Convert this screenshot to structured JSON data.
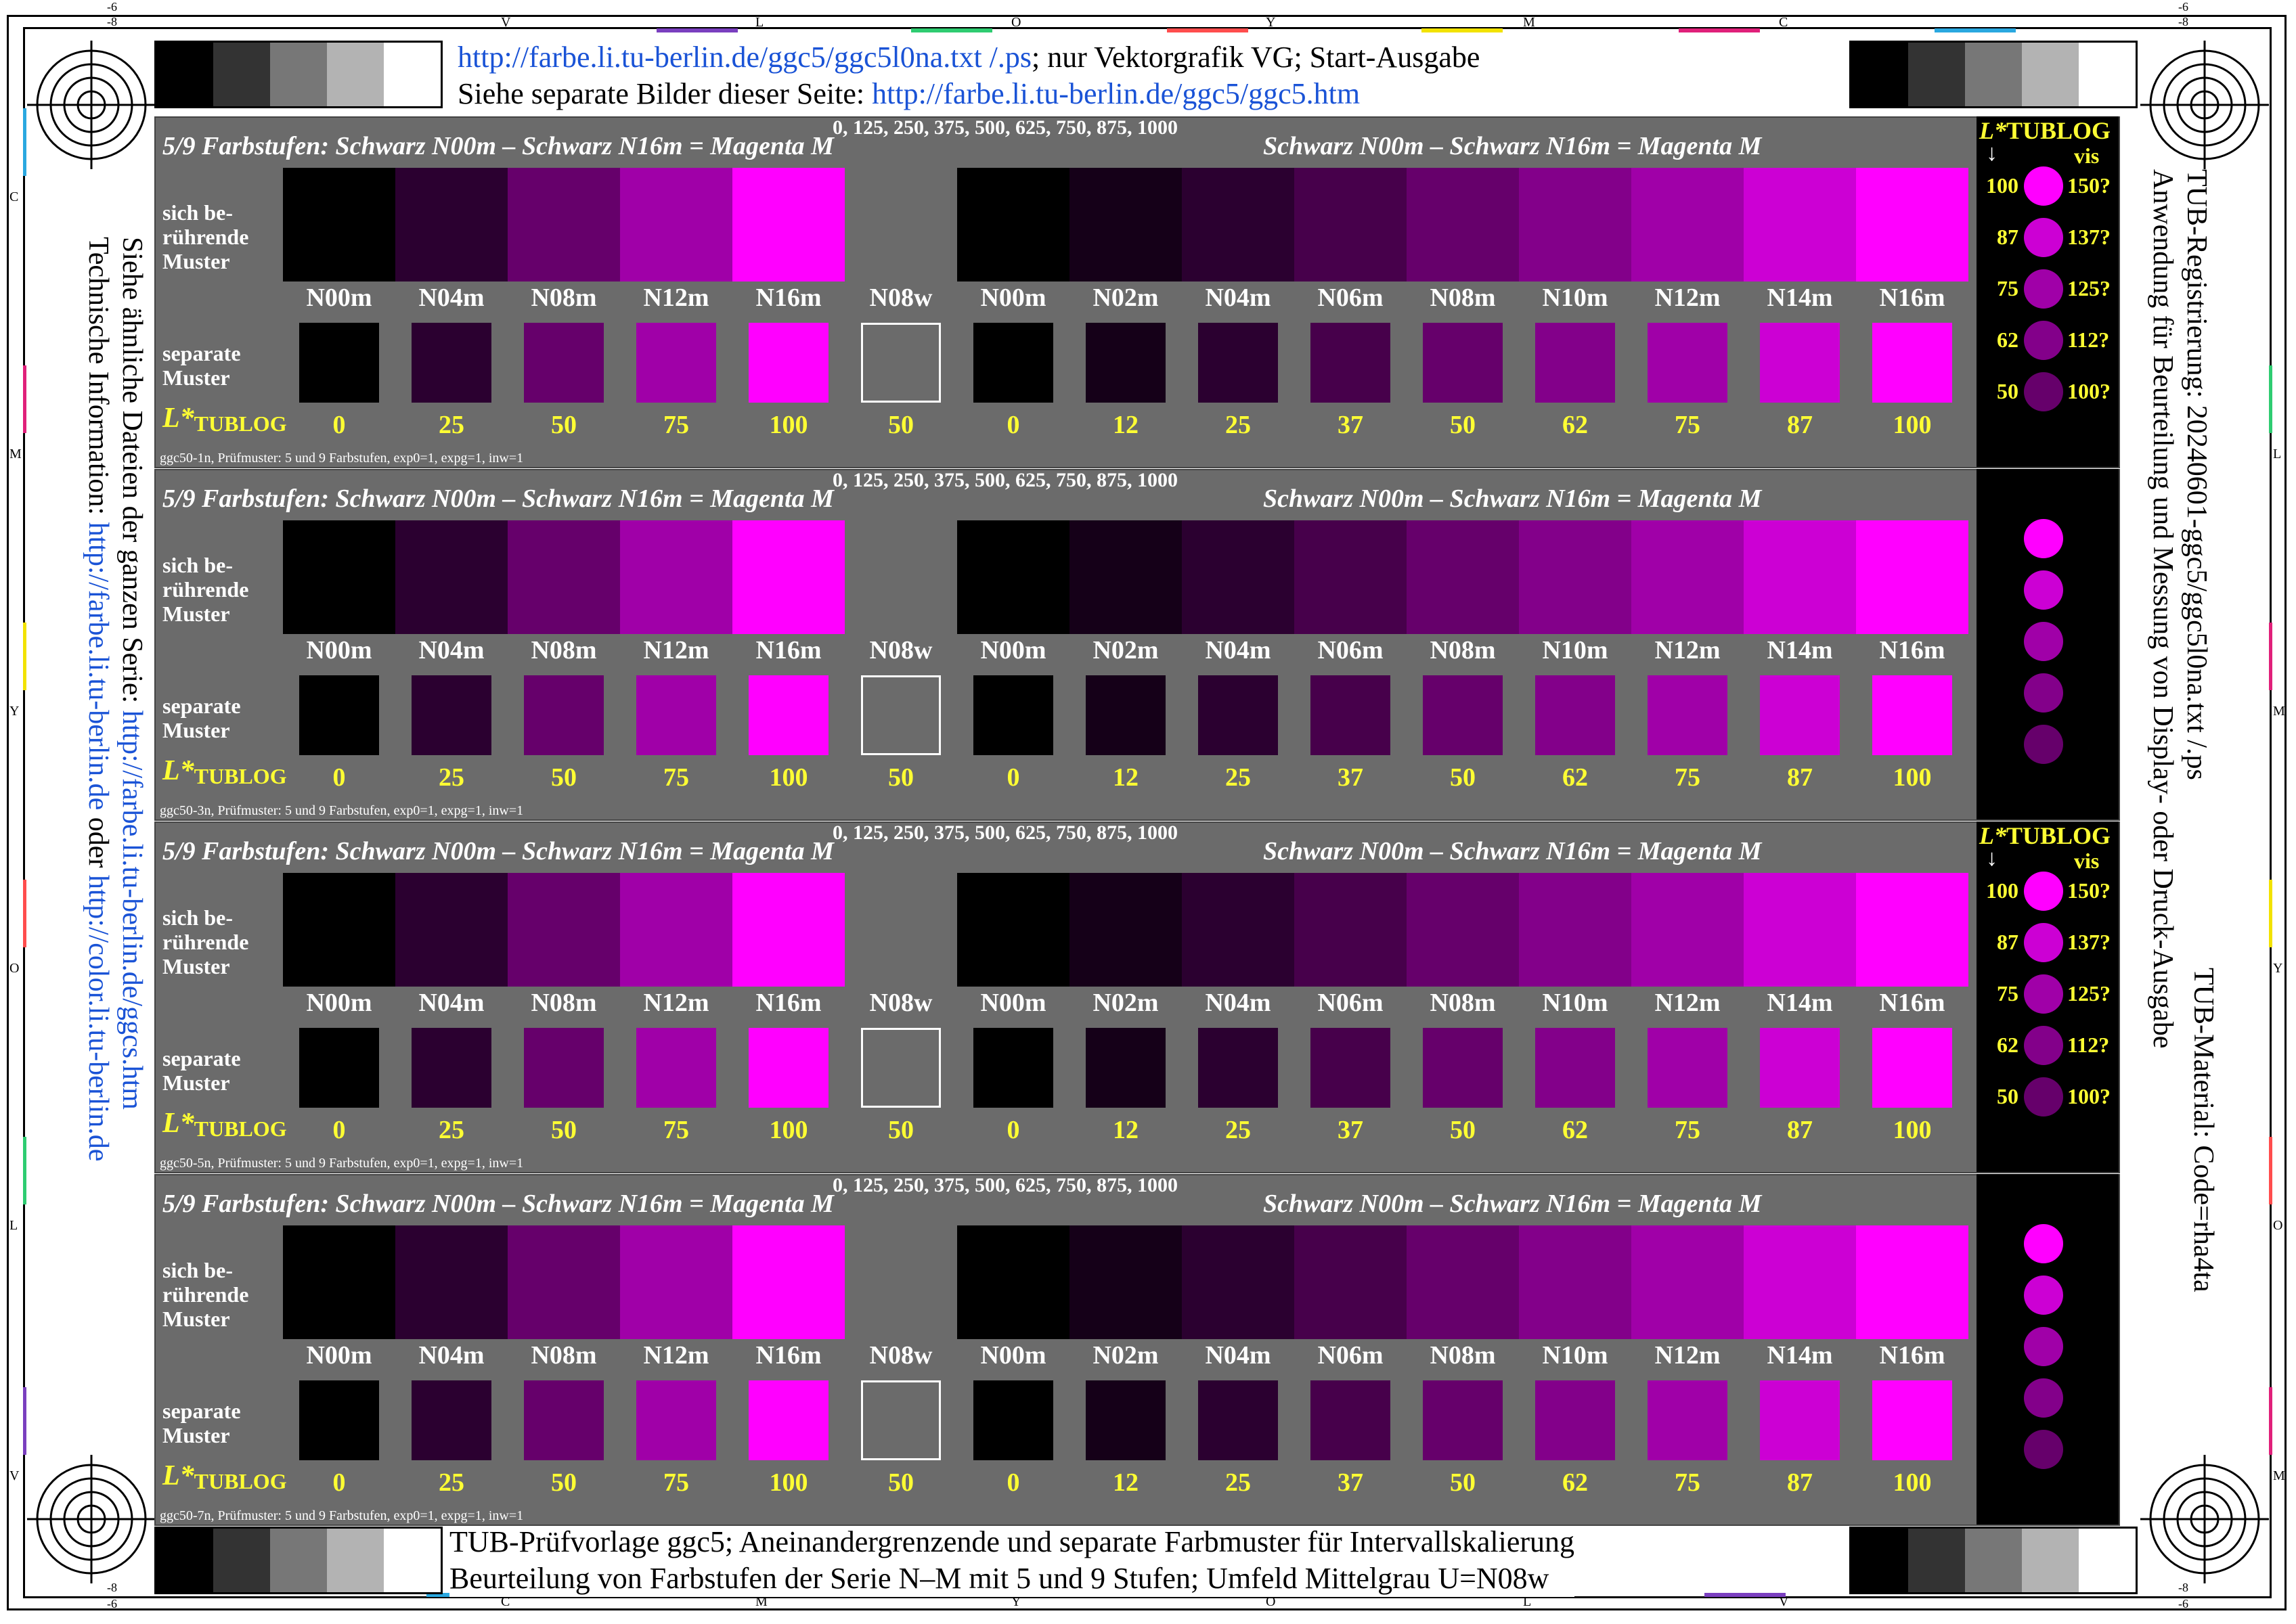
{
  "header": {
    "line1_link": "http://farbe.li.tu-berlin.de/ggc5/ggc5l0na.txt /.ps",
    "line1_rest": "; nur Vektorgrafik VG; Start-Ausgabe",
    "line2_text": "Siehe separate Bilder dieser Seite: ",
    "line2_link": "http://farbe.li.tu-berlin.de/ggc5/ggc5.htm"
  },
  "footer": {
    "line1": "TUB-Prüfvorlage ggc5; Aneinandergrenzende und separate Farbmuster für Intervallskalierung",
    "line2": "Beurteilung von Farbstufen der Serie N–M mit 5 und 9 Stufen; Umfeld Mittelgrau U=N08w"
  },
  "side_left": {
    "line1_text": "Siehe ähnliche Dateien der ganzen Serie: ",
    "line1_link": "http://farbe.li.tu-berlin.de/ggcs.htm",
    "line2_text": "Technische Information: ",
    "line2_link1": "http://farbe.li.tu-berlin.de",
    "line2_mid": " oder ",
    "line2_link2": "http://color.li.tu-berlin.de"
  },
  "side_right": {
    "line1": "TUB-Registrierung: 20240601-ggc5/ggc5l0na.txt /.ps",
    "line2": "Anwendung für Beurteilung und Messung von Display- oder Druck-Ausgabe",
    "line3": "TUB-Material: Code=rha4ta"
  },
  "edge": {
    "top_letters": [
      "V",
      "L",
      "O",
      "Y",
      "M",
      "C"
    ],
    "bottom_letters": [
      "C",
      "M",
      "Y",
      "O",
      "L",
      "V"
    ],
    "left_letters": [
      "C",
      "M",
      "Y",
      "O",
      "L",
      "V"
    ],
    "right_letters": [
      "L",
      "M",
      "Y",
      "O",
      "M"
    ],
    "tick_6": "-6",
    "tick_8": "-8"
  },
  "gray_steps": [
    "#000000",
    "#333333",
    "#777777",
    "#b3b3b3",
    "#ffffff"
  ],
  "panel_common": {
    "title_left": "5/9 Farbstufen:  Schwarz N00m – Schwarz N16m = Magenta M",
    "title_right": "Schwarz N00m – Schwarz N16m = Magenta M",
    "scale": "0, 125, 250, 375, 500, 625, 750, 875, 1000",
    "touch_label": [
      "sich be-",
      "rührende",
      "Muster"
    ],
    "sep_label": [
      "separate",
      "Muster"
    ],
    "lstar_main": "L*",
    "lstar_sub": "TUBLOG",
    "codes": [
      "N00m",
      "N04m",
      "N08m",
      "N12m",
      "N16m",
      "N08w",
      "N00m",
      "N02m",
      "N04m",
      "N06m",
      "N08m",
      "N10m",
      "N12m",
      "N14m",
      "N16m"
    ],
    "values": [
      "0",
      "25",
      "50",
      "75",
      "100",
      "50",
      "0",
      "12",
      "25",
      "37",
      "50",
      "62",
      "75",
      "87",
      "100"
    ],
    "colors": [
      "#000000",
      "#2b0030",
      "#66006b",
      "#a000a8",
      "#ff00ff",
      "#6b6b6b",
      "#000000",
      "#150018",
      "#2b0030",
      "#47004b",
      "#66006b",
      "#83008a",
      "#a000a8",
      "#cc00d4",
      "#ff00ff"
    ]
  },
  "panels": [
    {
      "foot": "ggc50-1n, Prüfmuster: 5 und 9 Farbstufen, exp0=1, expg=1, inw=1",
      "legend": true
    },
    {
      "foot": "ggc50-3n, Prüfmuster: 5 und 9 Farbstufen, exp0=1, expg=1, inw=1",
      "legend": false
    },
    {
      "foot": "ggc50-5n, Prüfmuster: 5 und 9 Farbstufen, exp0=1, expg=1, inw=1",
      "legend": true
    },
    {
      "foot": "ggc50-7n, Prüfmuster: 5 und 9 Farbstufen, exp0=1, expg=1, inw=1",
      "legend": false
    }
  ],
  "legend": {
    "head_main": "L*",
    "head_sub": "TUBLOG",
    "arrow": "↓",
    "vis": "vis",
    "rows": [
      {
        "l": "100",
        "r": "150?",
        "color": "#ff00ff"
      },
      {
        "l": "87",
        "r": "137?",
        "color": "#cc00d4"
      },
      {
        "l": "75",
        "r": "125?",
        "color": "#a000a8"
      },
      {
        "l": "62",
        "r": "112?",
        "color": "#83008a"
      },
      {
        "l": "50",
        "r": "100?",
        "color": "#66006b"
      }
    ]
  }
}
